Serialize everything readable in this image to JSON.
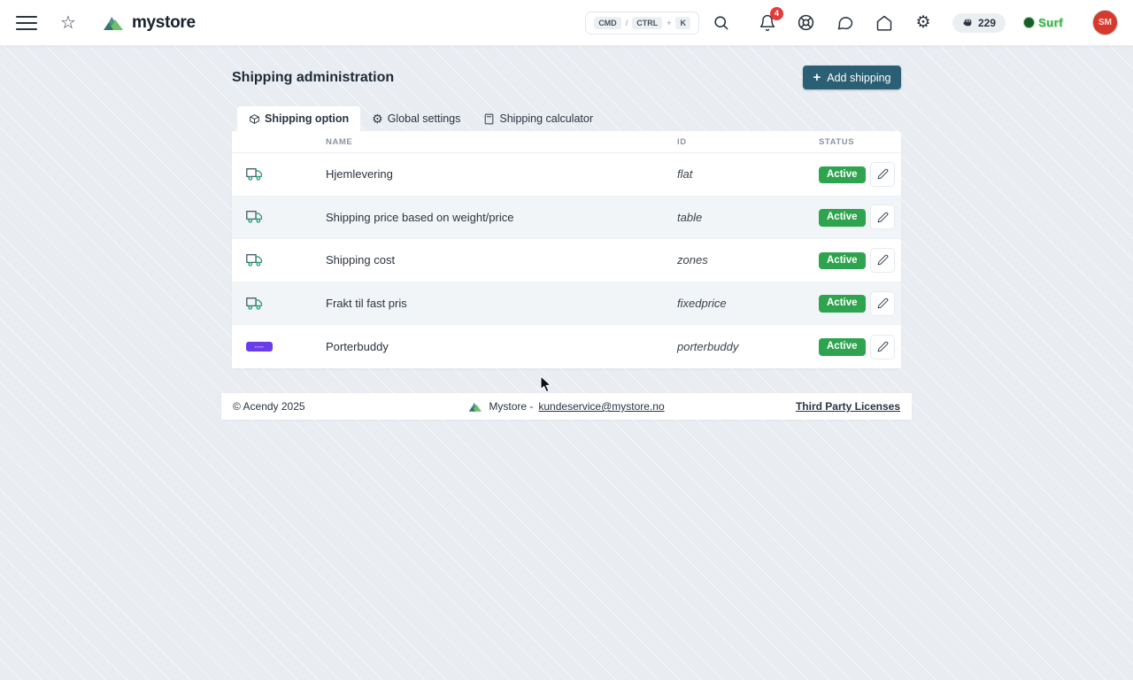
{
  "header": {
    "logo_text": "mystore",
    "search": {
      "key1": "CMD",
      "sep1": "/",
      "key2": "CTRL",
      "sep2": "+",
      "key3": "K"
    },
    "notification_count": "4",
    "credits": "229",
    "surf_label": "Surf",
    "avatar_initials": "SM"
  },
  "page": {
    "title": "Shipping administration",
    "add_button_plus": "+",
    "add_button_label": "Add shipping"
  },
  "tabs": [
    {
      "label": "Shipping option",
      "active": true
    },
    {
      "label": "Global settings",
      "active": false
    },
    {
      "label": "Shipping calculator",
      "active": false
    }
  ],
  "table": {
    "columns": [
      "NAME",
      "ID",
      "STATUS"
    ],
    "rows": [
      {
        "name": "Hjemlevering",
        "id": "flat",
        "status": "Active"
      },
      {
        "name": "Shipping price based on weight/price",
        "id": "table",
        "status": "Active"
      },
      {
        "name": "Shipping cost",
        "id": "zones",
        "status": "Active"
      },
      {
        "name": "Frakt til fast pris",
        "id": "fixedprice",
        "status": "Active"
      },
      {
        "name": "Porterbuddy",
        "id": "porterbuddy",
        "status": "Active"
      }
    ]
  },
  "footer": {
    "copyright": "© Acendy 2025",
    "brand": "Mystore -",
    "email": "kundeservice@mystore.no",
    "licenses": "Third Party Licenses"
  },
  "colors": {
    "page_background": "#e9edf2",
    "add_button": "#2a5f74",
    "active_badge": "#2fa44e",
    "notification_badge": "#e23d3d",
    "porterbuddy_purple": "#6b3ce9",
    "avatar_red": "#d8392f",
    "surf_green": "#3fae4e"
  }
}
